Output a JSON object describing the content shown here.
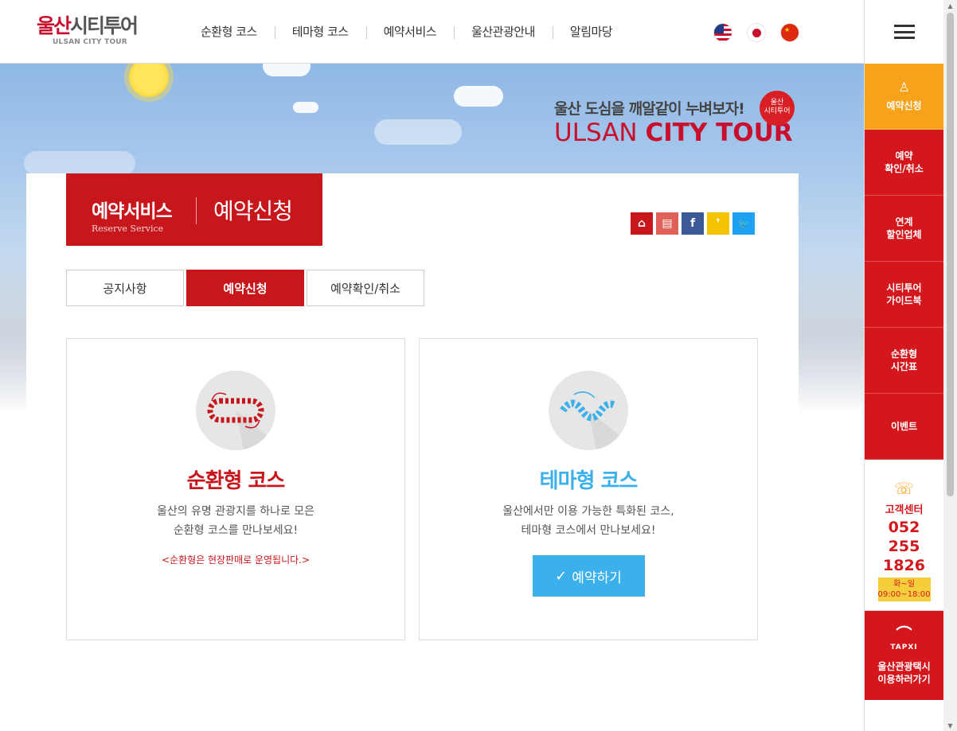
{
  "header": {
    "logo_main_red": "울산",
    "logo_main_rest": "시티투어",
    "logo_sub": "ULSAN CITY TOUR",
    "nav": [
      "순환형 코스",
      "테마형 코스",
      "예약서비스",
      "울산관광안내",
      "알림마당"
    ],
    "languages": [
      "us-flag-icon",
      "jp-flag-icon",
      "cn-flag-icon"
    ]
  },
  "banner": {
    "slogan_ko": "울산 도심을 깨알같이 누벼보자!",
    "slogan_en_light": "ULSAN ",
    "slogan_en_bold": "CITY TOUR",
    "badge_line1": "울산",
    "badge_line2": "시티투어"
  },
  "page_title": {
    "section": "예약서비스",
    "section_en": "Reserve Service",
    "current": "예약신청"
  },
  "sns": {
    "items": [
      "home-icon",
      "print-icon",
      "facebook-icon",
      "kakaostory-icon",
      "twitter-icon"
    ],
    "glyphs": [
      "⌂",
      "▤",
      "f",
      "❜",
      "🐦"
    ]
  },
  "tabs": [
    {
      "label": "공지사항",
      "active": false
    },
    {
      "label": "예약신청",
      "active": true
    },
    {
      "label": "예약확인/취소",
      "active": false
    }
  ],
  "courses": {
    "loop": {
      "name": "순환형 코스",
      "desc1": "울산의 유명 관광지를 하나로 모은",
      "desc2": "순환형 코스를 만나보세요!",
      "note": "<순환형은 현장판매로 운영됩니다.>",
      "color": "#c8161d"
    },
    "theme": {
      "name": "테마형 코스",
      "desc1": "울산에서만 이용 가능한 특화된 코스,",
      "desc2": "테마형 코스에서 만나보세요!",
      "button": "예약하기",
      "color": "#3bb0ea"
    }
  },
  "quick_menu": {
    "apply": "예약신청",
    "items": [
      [
        "예약",
        "확인/취소"
      ],
      [
        "연계",
        "할인업체"
      ],
      [
        "시티투어",
        "가이드북"
      ],
      [
        "순환형",
        "시간표"
      ],
      [
        "이벤트",
        ""
      ]
    ],
    "center": {
      "label": "고객센터",
      "phone": [
        "052",
        "255",
        "1826"
      ],
      "days": "화~일",
      "hours": "09:00~18:00"
    },
    "taxi": {
      "brand": "TAPXI",
      "line1": "울산관광택시",
      "line2": "이용하러가기"
    }
  },
  "colors": {
    "brand_red": "#c8161d",
    "quick_red": "#d4161d",
    "apply_orange": "#f7a21b",
    "theme_blue": "#3bb0ea"
  }
}
